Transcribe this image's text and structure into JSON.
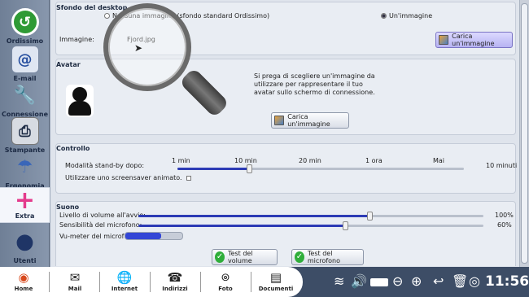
{
  "sidebar": {
    "items": [
      {
        "label": "Ordissimo",
        "icon": "green-refresh-icon"
      },
      {
        "label": "E-mail",
        "icon": "email-icon"
      },
      {
        "label": "Connessione",
        "icon": "connection-tools-icon"
      },
      {
        "label": "Stampante",
        "icon": "printer-icon"
      },
      {
        "label": "Ergonomia",
        "icon": "ergonomics-icon"
      },
      {
        "label": "Extra",
        "icon": "plus-icon"
      },
      {
        "label": "Utenti",
        "icon": "user-icon"
      }
    ]
  },
  "desktop": {
    "title": "Sfondo del desktop",
    "option_none": "Nessuna immagine (sfondo standard Ordissimo)",
    "option_image": "Un'immagine",
    "image_label": "Immagine:",
    "image_value": "Fjord.jpg",
    "load_button": "Carica un'immagine"
  },
  "avatar": {
    "title": "Avatar",
    "hint": "Si prega di scegliere un'immagine da utilizzare per rappresentare il tuo avatar sullo schermo di connessione.",
    "load_button": "Carica un'immagine"
  },
  "control": {
    "title": "Controllo",
    "standby_label": "Modalità stand-by dopo:",
    "ticks": [
      "1 min",
      "10 min",
      "20 min",
      "1 ora",
      "Mai"
    ],
    "standby_value": "10 minuti",
    "standby_fraction": 0.25,
    "screensaver_label": "Utilizzare uno screensaver animato."
  },
  "sound": {
    "title": "Suono",
    "volume_label": "Livello di volume all'avvio:",
    "volume_value": "100%",
    "volume_fraction": 1.0,
    "mic_label": "Sensibilità del microfono:",
    "mic_value": "60%",
    "mic_fraction": 0.6,
    "vumeter_label": "Vu-meter del microfono:",
    "test_volume": "Test del volume",
    "test_mic": "Test del microfono"
  },
  "taskbar": {
    "items": [
      "Home",
      "Mail",
      "Internet",
      "Indirizzi",
      "Foto",
      "Documenti"
    ],
    "clock": "11:56"
  },
  "colors": {
    "accent": "#2d3bb5",
    "taskbar": "#3d4d66",
    "panel": "#dfe4ec"
  }
}
